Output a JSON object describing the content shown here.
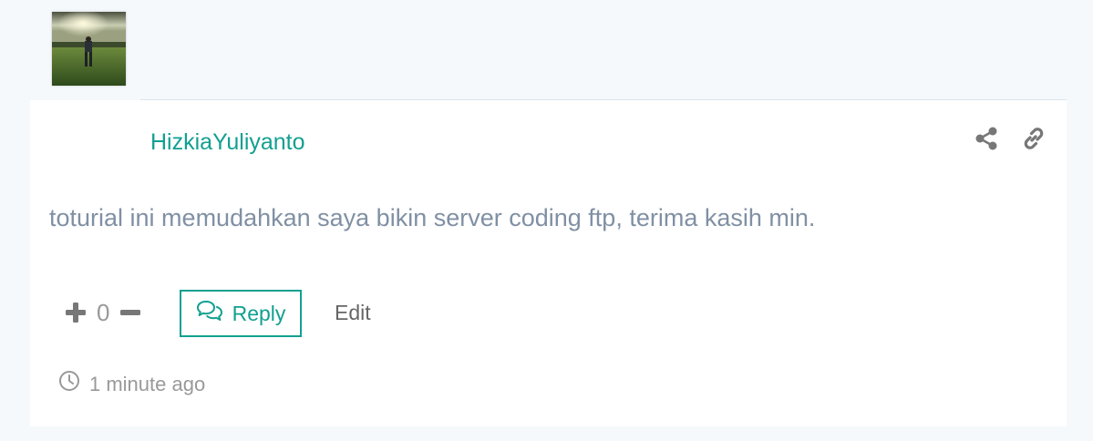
{
  "comment": {
    "author": "HizkiaYuliyanto",
    "text": "toturial ini memudahkan saya bikin server coding ftp, terima kasih min.",
    "vote_count": "0",
    "reply_label": "Reply",
    "edit_label": "Edit",
    "timestamp": "1 minute ago"
  },
  "icons": {
    "share": "share-icon",
    "link": "link-icon",
    "upvote": "plus-icon",
    "downvote": "minus-icon",
    "reply": "comments-icon",
    "time": "clock-icon"
  },
  "colors": {
    "accent": "#12a090",
    "text_muted": "#8090a4",
    "icon_gray": "#777777",
    "background": "#f5f9fc"
  }
}
